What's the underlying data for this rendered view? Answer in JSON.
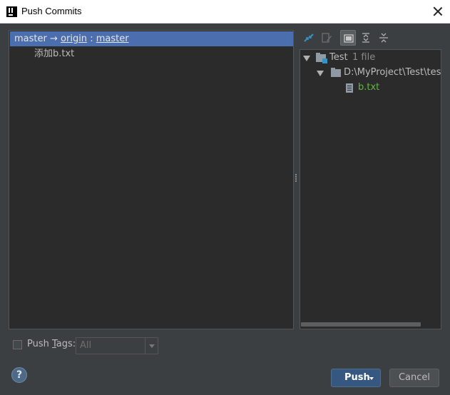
{
  "window": {
    "title": "Push Commits",
    "close_icon": "close-icon"
  },
  "commits_panel": {
    "branch_local": "master",
    "arrow": "→",
    "remote": "origin",
    "separator": ":",
    "branch_remote": "master",
    "commit_message": "添加b.txt"
  },
  "toolbar": {
    "icons": [
      "show-diff-icon",
      "edit-source-icon",
      "group-by-directory-icon",
      "expand-all-icon",
      "collapse-all-icon"
    ]
  },
  "tree": {
    "module_name": "Test",
    "module_count": "1 file",
    "directory": "D:\\MyProject\\Test\\test",
    "file_name": "b.txt"
  },
  "footer": {
    "push_tags_prefix": "Push ",
    "push_tags_mnemonic": "T",
    "push_tags_suffix": "ags:",
    "tags_combo_value": "All",
    "help_label": "?",
    "push_label": "Push",
    "cancel_label": "Cancel"
  },
  "colors": {
    "selection": "#4b6eaf",
    "push_button": "#365880",
    "modified_file": "#62b543"
  }
}
